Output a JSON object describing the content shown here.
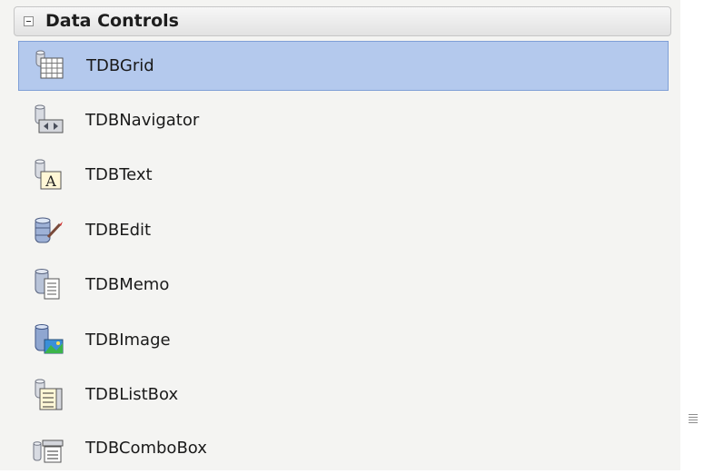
{
  "category": {
    "title": "Data Controls",
    "expanded": true
  },
  "items": [
    {
      "label": "TDBGrid",
      "icon": "db-grid-icon",
      "selected": true
    },
    {
      "label": "TDBNavigator",
      "icon": "db-navigator-icon",
      "selected": false
    },
    {
      "label": "TDBText",
      "icon": "db-text-icon",
      "selected": false
    },
    {
      "label": "TDBEdit",
      "icon": "db-edit-icon",
      "selected": false
    },
    {
      "label": "TDBMemo",
      "icon": "db-memo-icon",
      "selected": false
    },
    {
      "label": "TDBImage",
      "icon": "db-image-icon",
      "selected": false
    },
    {
      "label": "TDBListBox",
      "icon": "db-listbox-icon",
      "selected": false
    },
    {
      "label": "TDBComboBox",
      "icon": "db-combobox-icon",
      "selected": false
    }
  ],
  "colors": {
    "selection": "#b4c9ed",
    "selection_border": "#7f9fd6",
    "panel": "#f4f4f2"
  }
}
